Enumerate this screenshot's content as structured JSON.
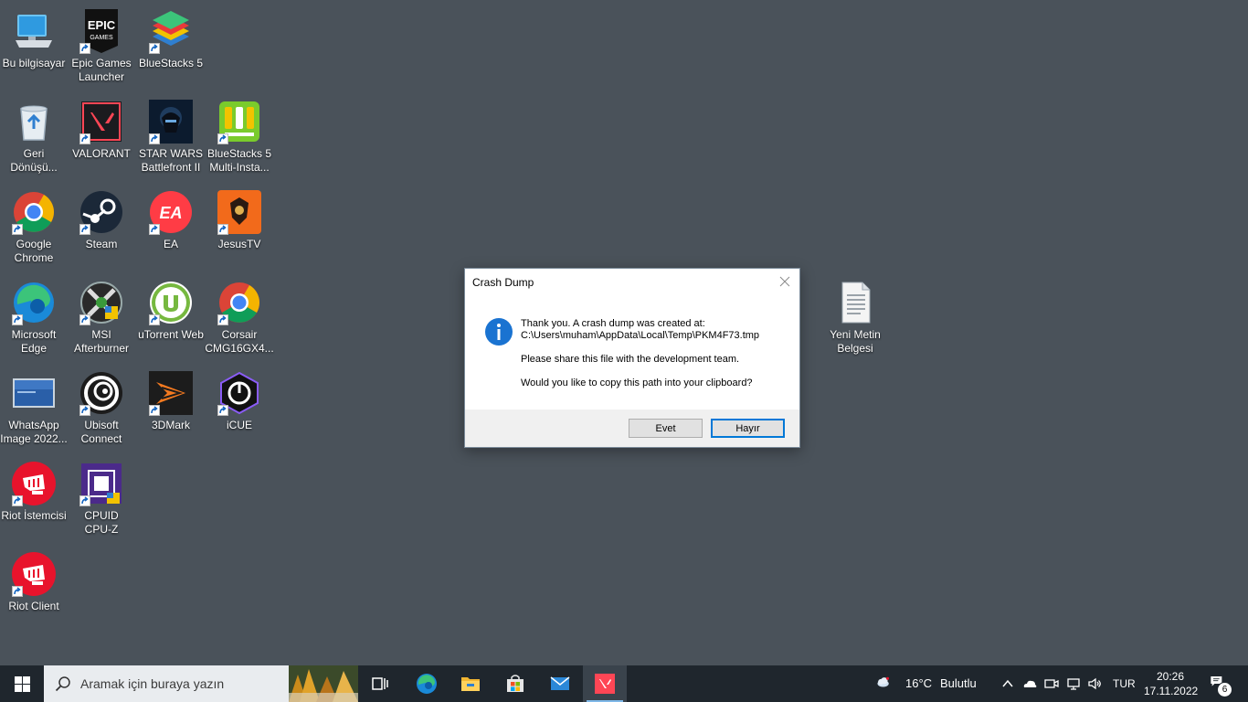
{
  "desktop_icons": [
    {
      "label": "Bu bilgisayar",
      "icon": "this-pc-icon"
    },
    {
      "label": "Epic Games\nLauncher",
      "icon": "epic-games-icon"
    },
    {
      "label": "BlueStacks 5",
      "icon": "bluestacks-icon"
    },
    {
      "label": "Geri\nDönüşü...",
      "icon": "recycle-bin-icon"
    },
    {
      "label": "VALORANT",
      "icon": "valorant-icon"
    },
    {
      "label": "STAR WARS\nBattlefront II",
      "icon": "star-wars-icon"
    },
    {
      "label": "BlueStacks 5\nMulti-Insta...",
      "icon": "bluestacks-multi-icon"
    },
    {
      "label": "Google\nChrome",
      "icon": "chrome-icon"
    },
    {
      "label": "Steam",
      "icon": "steam-icon"
    },
    {
      "label": "EA",
      "icon": "ea-icon"
    },
    {
      "label": "JesusTV",
      "icon": "jesustv-icon"
    },
    {
      "label": "Microsoft\nEdge",
      "icon": "edge-icon"
    },
    {
      "label": "MSI\nAfterburner",
      "icon": "msi-afterburner-icon"
    },
    {
      "label": "uTorrent Web",
      "icon": "utorrent-icon"
    },
    {
      "label": "Corsair\nCMG16GX4...",
      "icon": "corsair-chrome-icon"
    },
    {
      "label": "WhatsApp\nImage 2022...",
      "icon": "image-file-icon"
    },
    {
      "label": "Ubisoft\nConnect",
      "icon": "ubisoft-icon"
    },
    {
      "label": "3DMark",
      "icon": "3dmark-icon"
    },
    {
      "label": "iCUE",
      "icon": "icue-icon"
    },
    {
      "label": "Riot İstemcisi",
      "icon": "riot-icon"
    },
    {
      "label": "CPUID\nCPU-Z",
      "icon": "cpuz-icon"
    },
    {
      "label": "Riot Client",
      "icon": "riot-client-icon"
    },
    {
      "label": "Yeni Metin\nBelgesi",
      "icon": "text-document-icon"
    }
  ],
  "dialog": {
    "title": "Crash Dump",
    "line1": "Thank you. A crash dump was created at:",
    "line2": "C:\\Users\\muham\\AppData\\Local\\Temp\\PKM4F73.tmp",
    "line3": "Please share this file with the development team.",
    "line4": "Would you like to copy this path into your clipboard?",
    "yes_label": "Evet",
    "no_label": "Hayır"
  },
  "taskbar": {
    "search_placeholder": "Aramak için buraya yazın",
    "weather_temp": "16°C",
    "weather_desc": "Bulutlu",
    "language": "TUR",
    "time": "20:26",
    "date": "17.11.2022",
    "notification_count": "6",
    "apps": [
      "task-view-icon",
      "edge-icon",
      "file-explorer-icon",
      "microsoft-store-icon",
      "mail-icon",
      "valorant-icon"
    ]
  },
  "colors": {
    "desktop_bg": "#4a525a",
    "taskbar_bg": "#1f262d",
    "accent": "#0078d7",
    "info_blue": "#1a73d1"
  }
}
